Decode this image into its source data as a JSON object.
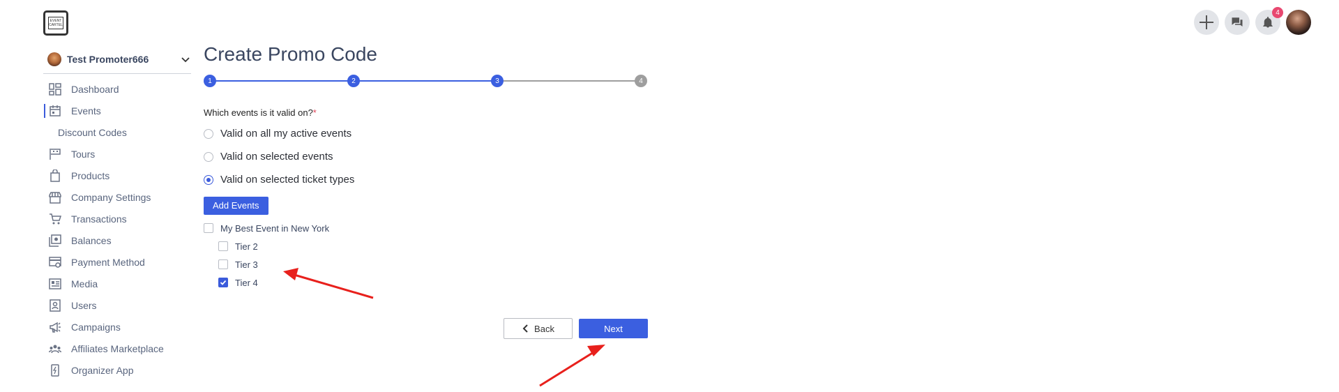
{
  "brand": {
    "logo_text": "EVENT CARTEL"
  },
  "header": {
    "notifications_count": "4",
    "icons": [
      "plus-icon",
      "chat-icon",
      "bell-icon"
    ]
  },
  "sidebar": {
    "account_name": "Test Promoter666",
    "items": [
      {
        "label": "Dashboard",
        "icon": "dashboard-icon",
        "active": false
      },
      {
        "label": "Events",
        "icon": "calendar-icon",
        "active": true
      },
      {
        "label": "Discount Codes",
        "icon": "",
        "active": false,
        "sub": true
      },
      {
        "label": "Tours",
        "icon": "flag-icon",
        "active": false
      },
      {
        "label": "Products",
        "icon": "bag-icon",
        "active": false
      },
      {
        "label": "Company Settings",
        "icon": "store-icon",
        "active": false
      },
      {
        "label": "Transactions",
        "icon": "cart-icon",
        "active": false
      },
      {
        "label": "Balances",
        "icon": "balance-icon",
        "active": false
      },
      {
        "label": "Payment Method",
        "icon": "payment-icon",
        "active": false
      },
      {
        "label": "Media",
        "icon": "media-icon",
        "active": false
      },
      {
        "label": "Users",
        "icon": "users-icon",
        "active": false
      },
      {
        "label": "Campaigns",
        "icon": "megaphone-icon",
        "active": false
      },
      {
        "label": "Affiliates Marketplace",
        "icon": "affiliates-icon",
        "active": false
      },
      {
        "label": "Organizer App",
        "icon": "phone-icon",
        "active": false
      }
    ]
  },
  "main": {
    "title": "Create Promo Code",
    "steps": [
      {
        "label": "1",
        "state": "complete"
      },
      {
        "label": "2",
        "state": "complete"
      },
      {
        "label": "3",
        "state": "current"
      },
      {
        "label": "4",
        "state": "upcoming"
      }
    ],
    "question": "Which events is it valid on?",
    "required_mark": "*",
    "options": [
      {
        "label": "Valid on all my active events",
        "checked": false
      },
      {
        "label": "Valid on selected events",
        "checked": false
      },
      {
        "label": "Valid on selected ticket types",
        "checked": true
      }
    ],
    "add_events_label": "Add Events",
    "event": {
      "name": "My Best Event in New York",
      "checked": false
    },
    "tiers": [
      {
        "label": "Tier 2",
        "checked": false
      },
      {
        "label": "Tier 3",
        "checked": false
      },
      {
        "label": "Tier 4",
        "checked": true
      }
    ],
    "back_label": "Back",
    "next_label": "Next"
  },
  "colors": {
    "accent": "#3b5fe0",
    "step_inactive": "#9e9e9e",
    "annotation_arrow": "#e8201c",
    "badge": "#e84870"
  }
}
